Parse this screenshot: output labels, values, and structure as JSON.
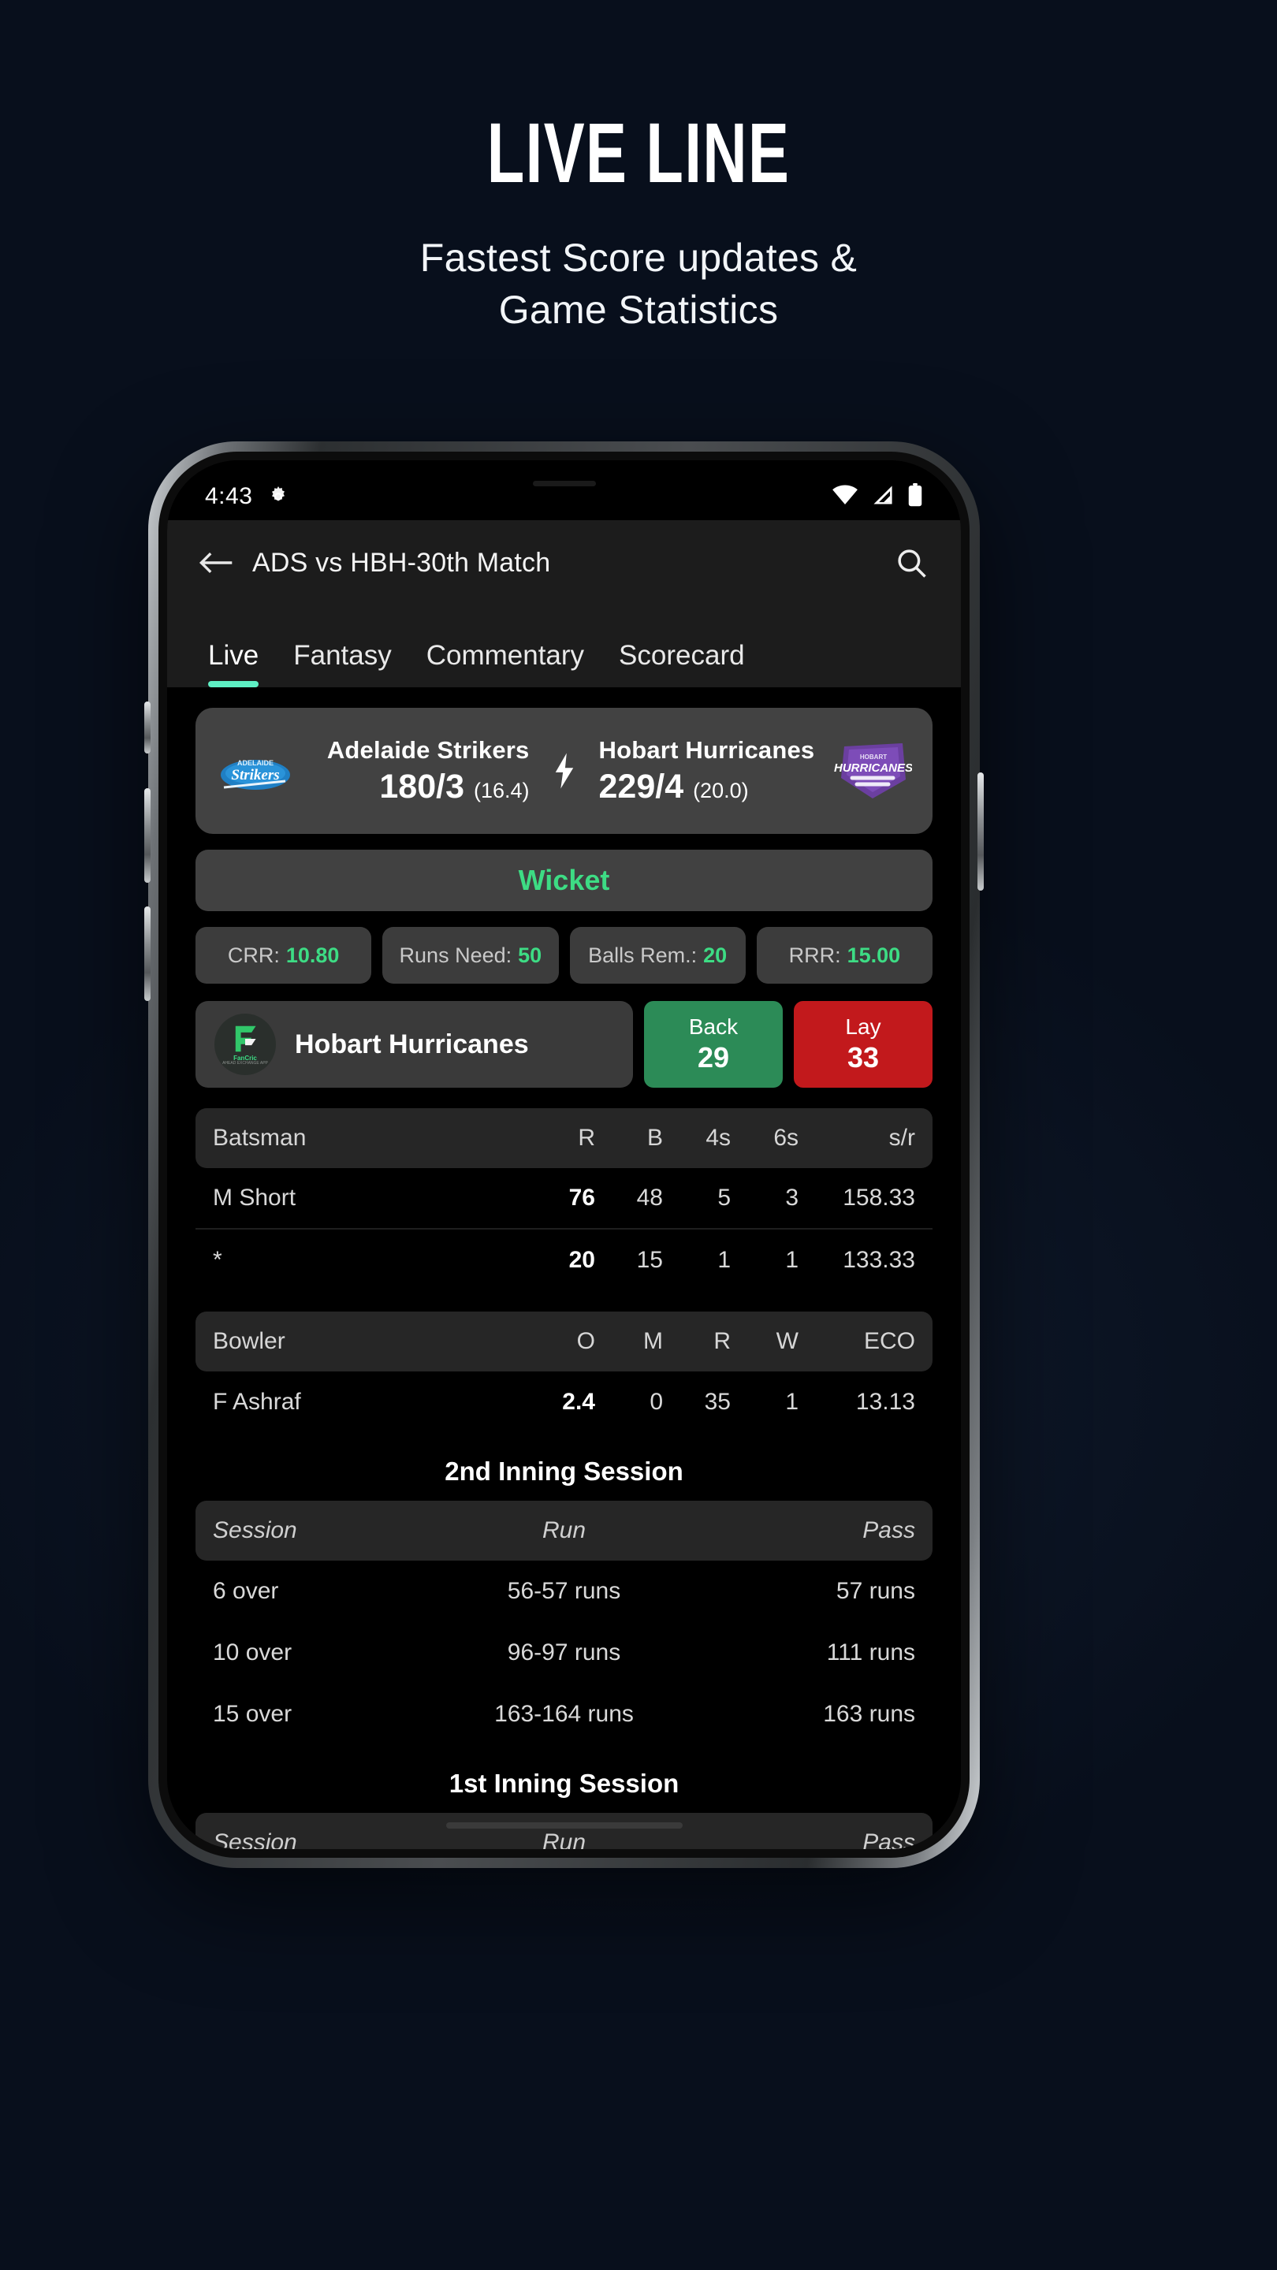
{
  "promo": {
    "headline": "LIVE LINE",
    "subhead_line1": "Fastest Score updates &",
    "subhead_line2": "Game Statistics"
  },
  "status_bar": {
    "time": "4:43",
    "gear_icon": "gear-icon",
    "wifi_icon": "wifi-icon",
    "signal_icon": "signal-icon",
    "battery_icon": "battery-icon"
  },
  "appbar": {
    "back_icon": "back-arrow-icon",
    "title": "ADS vs HBH-30th Match",
    "search_icon": "search-icon"
  },
  "tabs": [
    {
      "label": "Live",
      "active": true
    },
    {
      "label": "Fantasy",
      "active": false
    },
    {
      "label": "Commentary",
      "active": false
    },
    {
      "label": "Scorecard",
      "active": false
    }
  ],
  "scorecard": {
    "team_left": {
      "name": "Adelaide Strikers",
      "score": "180/3",
      "overs": "(16.4)",
      "logo": "adelaide-strikers-logo"
    },
    "separator_icon": "lightning-bolt-icon",
    "team_right": {
      "name": "Hobart Hurricanes",
      "score": "229/4",
      "overs": "(20.0)",
      "logo": "hobart-hurricanes-logo"
    }
  },
  "status_banner": {
    "text": "Wicket",
    "color": "#3ddc84"
  },
  "chips": [
    {
      "label": "CRR:",
      "value": "10.80"
    },
    {
      "label": "Runs Need:",
      "value": "50"
    },
    {
      "label": "Balls Rem.:",
      "value": "20"
    },
    {
      "label": "RRR:",
      "value": "15.00"
    }
  ],
  "bet_row": {
    "brand": {
      "name": "FanCric",
      "tagline": "AHEAD EXCHANGE APP"
    },
    "team": "Hobart Hurricanes",
    "back": {
      "label": "Back",
      "value": "29",
      "color": "#2c8b57"
    },
    "lay": {
      "label": "Lay",
      "value": "33",
      "color": "#c2191c"
    }
  },
  "batsman_table": {
    "headers": [
      "Batsman",
      "R",
      "B",
      "4s",
      "6s",
      "s/r"
    ],
    "rows": [
      {
        "name": "M Short",
        "r": "76",
        "b": "48",
        "fours": "5",
        "sixes": "3",
        "sr": "158.33"
      },
      {
        "name": "*",
        "r": "20",
        "b": "15",
        "fours": "1",
        "sixes": "1",
        "sr": "133.33"
      }
    ]
  },
  "bowler_table": {
    "headers": [
      "Bowler",
      "O",
      "M",
      "R",
      "W",
      "ECO"
    ],
    "rows": [
      {
        "name": "F Ashraf",
        "o": "2.4",
        "m": "0",
        "r": "35",
        "w": "1",
        "eco": "13.13"
      }
    ]
  },
  "sessions": [
    {
      "title": "2nd Inning Session",
      "headers": [
        "Session",
        "Run",
        "Pass"
      ],
      "rows": [
        {
          "session": "6 over",
          "run": "56-57 runs",
          "pass": "57 runs"
        },
        {
          "session": "10 over",
          "run": "96-97 runs",
          "pass": "111 runs"
        },
        {
          "session": "15 over",
          "run": "163-164 runs",
          "pass": "163 runs"
        }
      ]
    },
    {
      "title": "1st Inning Session",
      "headers": [
        "Session",
        "Run",
        "Pass"
      ],
      "rows": []
    }
  ]
}
